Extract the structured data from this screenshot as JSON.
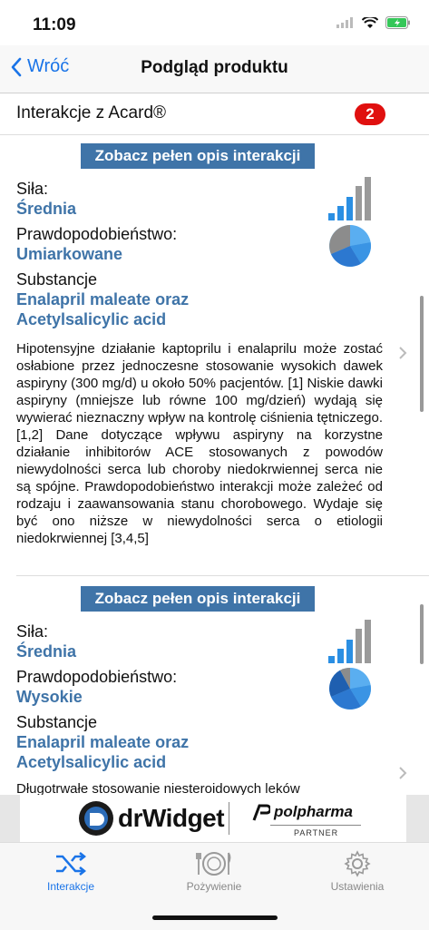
{
  "status": {
    "time": "11:09"
  },
  "nav": {
    "back_label": "Wróć",
    "title": "Podgląd produktu"
  },
  "header": {
    "label": "Interakcje z Acard®",
    "badge": "2"
  },
  "interactions": [
    {
      "button_label": "Zobacz pełen opis interakcji",
      "strength_label": "Siła:",
      "strength_value": "Średnia",
      "prob_label": "Prawdopodobieństwo:",
      "prob_value": "Umiarkowane",
      "subst_label": "Substancje",
      "subst_line1": "Enalapril maleate oraz",
      "subst_line2": "Acetylsalicylic acid",
      "description": "Hipotensyjne działanie kaptoprilu i enalaprilu może zostać osłabione przez jednoczesne stosowanie wysokich dawek aspiryny (300 mg/d) u około 50% pacjentów. [1] Niskie dawki aspiryny (mniejsze lub równe 100 mg/dzień) wydają się wywierać nieznaczny wpływ na kontrolę ciśnienia tętniczego. [1,2] Dane dotyczące wpływu aspiryny na korzystne działanie inhibitorów ACE stosowanych z powodów niewydolności serca lub choroby niedokrwiennej serca nie są spójne. Prawdopodobieństwo interakcji może zależeć od rodzaju i zaawansowania stanu chorobowego. Wydaje się być ono niższe w niewydolności serca o etiologii niedokrwiennej [3,4,5]"
    },
    {
      "button_label": "Zobacz pełen opis interakcji",
      "strength_label": "Siła:",
      "strength_value": "Średnia",
      "prob_label": "Prawdopodobieństwo:",
      "prob_value": "Wysokie",
      "subst_label": "Substancje",
      "subst_line1": "Enalapril maleate oraz",
      "subst_line2": "Acetylsalicylic acid",
      "description": "Długotrwałe stosowanie niesteroidowych leków"
    }
  ],
  "banner": {
    "brand": "drWidget",
    "partner_brand": "polpharma",
    "partner_label": "PARTNER"
  },
  "tabs": [
    {
      "label": "Interakcje",
      "icon": "shuffle-icon",
      "active": true
    },
    {
      "label": "Pożywienie",
      "icon": "plate-icon",
      "active": false
    },
    {
      "label": "Ustawienia",
      "icon": "gear-icon",
      "active": false
    }
  ],
  "colors": {
    "accent": "#1a74e8",
    "brand_blue": "#3f74a8",
    "badge_red": "#e0100f"
  }
}
